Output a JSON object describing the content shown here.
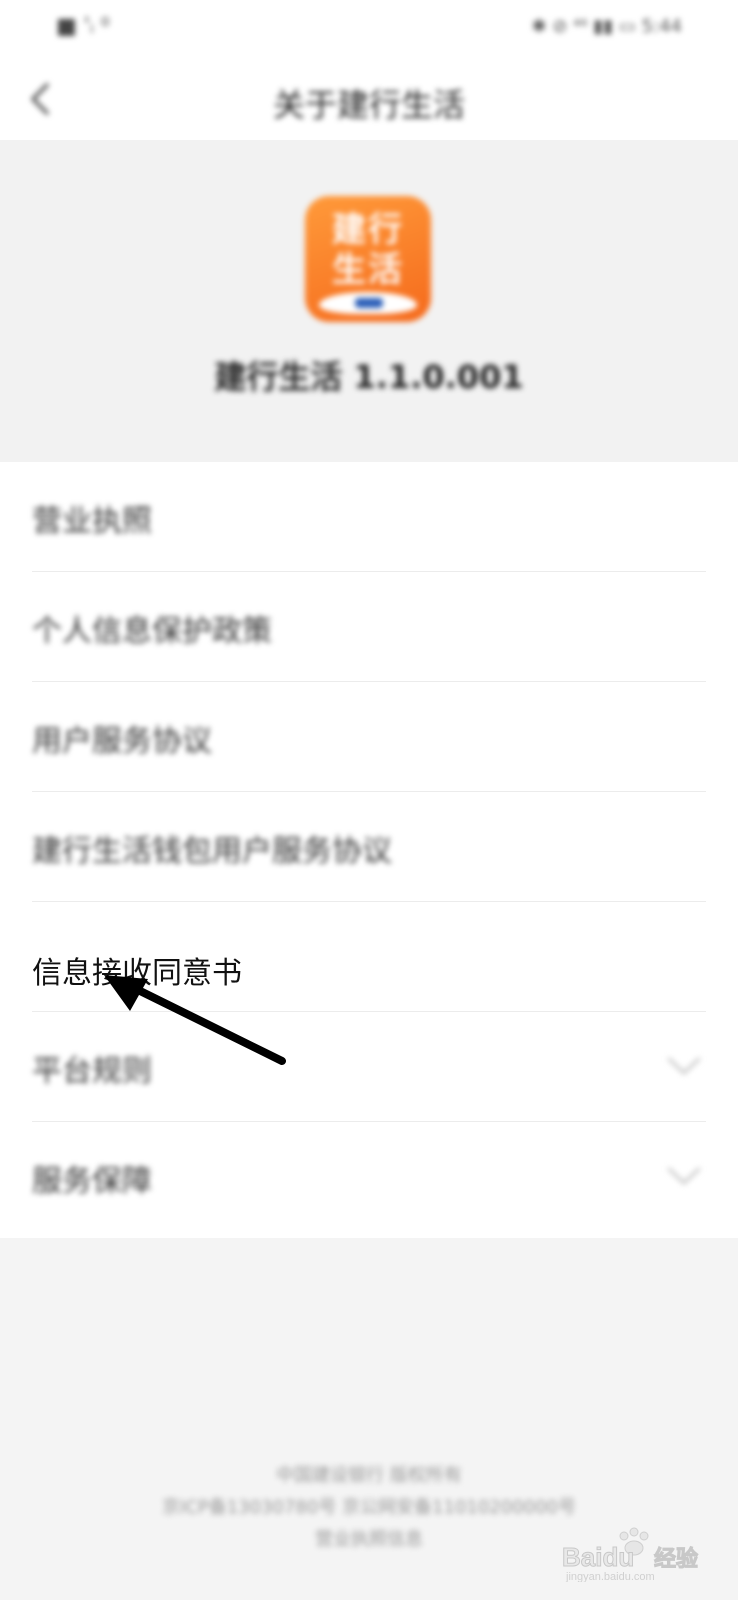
{
  "status_bar": {
    "left_text": "■ 'ᵢ ⁰",
    "right_text": "✱ ⊘ ⁴⁶ ▮▮ ▭ 5:44"
  },
  "nav": {
    "title": "关于建行生活"
  },
  "app": {
    "icon_text": "建行生活",
    "version_text": "建行生活 1.1.0.001",
    "brand_color": "#f56a1c"
  },
  "menu": {
    "items": [
      {
        "label": "营业执照",
        "has_chevron": false
      },
      {
        "label": "个人信息保护政策",
        "has_chevron": false
      },
      {
        "label": "用户服务协议",
        "has_chevron": false
      },
      {
        "label": "建行生活钱包用户服务协议",
        "has_chevron": false
      },
      {
        "label": "",
        "has_chevron": false
      },
      {
        "label": "平台规则",
        "has_chevron": true
      },
      {
        "label": "服务保障",
        "has_chevron": true
      }
    ]
  },
  "annotation": {
    "highlighted_label": "信息接收同意书",
    "arrow_color": "#000000"
  },
  "footer": {
    "line1": "中国建设银行 版权所有",
    "line2": "京ICP备13030780号 京公网安备11010200000号",
    "line3": "营业执照信息"
  },
  "watermark": {
    "brand": "Baidu",
    "tag": "经验",
    "url": "jingyan.baidu.com"
  }
}
